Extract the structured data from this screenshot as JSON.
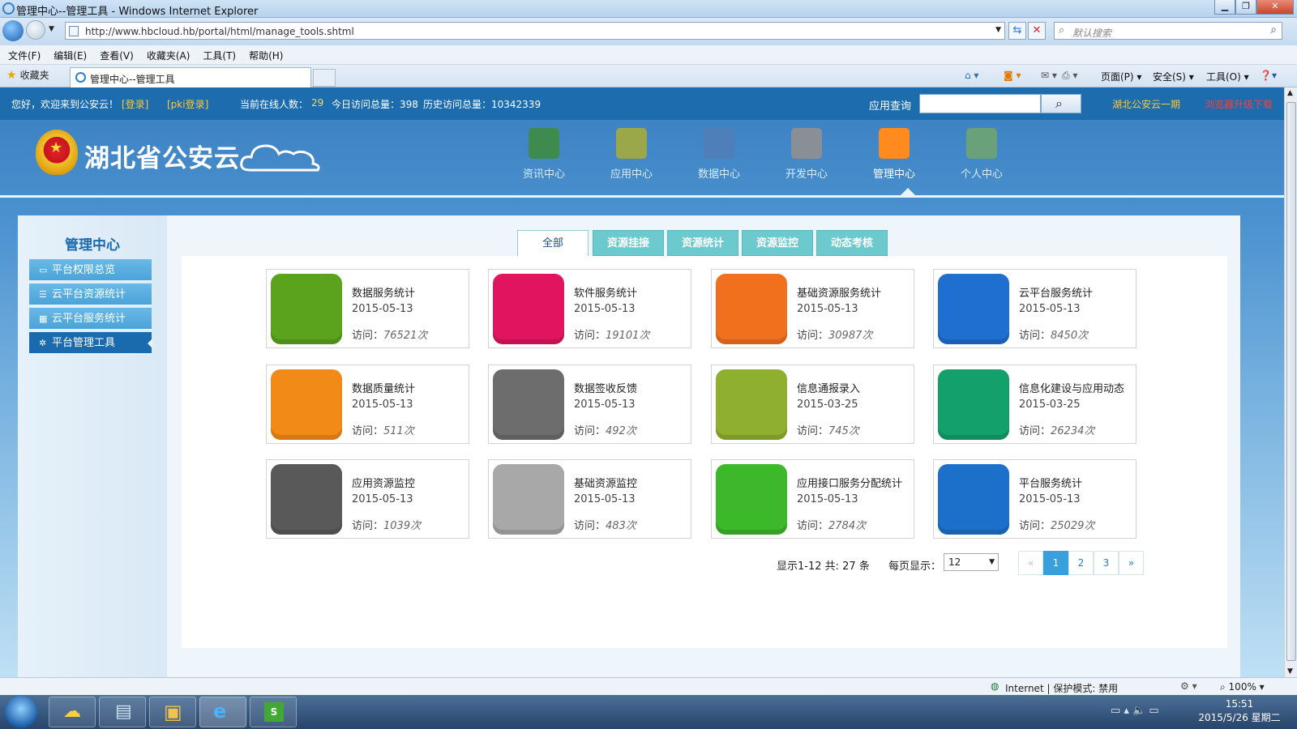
{
  "browser": {
    "window_title": "管理中心--管理工具 - Windows Internet Explorer",
    "url": "http://www.hbcloud.hb/portal/html/manage_tools.shtml",
    "search_placeholder": "默认搜索",
    "menu": [
      "文件(F)",
      "编辑(E)",
      "查看(V)",
      "收藏夹(A)",
      "工具(T)",
      "帮助(H)"
    ],
    "favorites_label": "收藏夹",
    "tab_title": "管理中心--管理工具",
    "commands": {
      "page": "页面(P)",
      "safety": "安全(S)",
      "tools": "工具(O)"
    },
    "status_zone": "Internet | 保护模式: 禁用",
    "zoom": "100%"
  },
  "site": {
    "welcome": "您好，欢迎来到公安云！",
    "login": "[登录]",
    "pki_login": "[pki登录]",
    "online_label": "当前在线人数：",
    "online_count": "29",
    "today_visits": "今日访问总量：398",
    "history_visits": "历史访问总量：10342339",
    "app_query_label": "应用查询",
    "phase_link": "湖北公安云一期",
    "browser_upgrade": "浏览器升级下载",
    "logo_text": "湖北省公安云",
    "nav": [
      {
        "label": "资讯中心",
        "icon": "news-icon",
        "color": "#3f8a4f"
      },
      {
        "label": "应用中心",
        "icon": "app-icon",
        "color": "#9aa84a"
      },
      {
        "label": "数据中心",
        "icon": "data-icon",
        "color": "#4f7fb8"
      },
      {
        "label": "开发中心",
        "icon": "dev-icon",
        "color": "#8a8f96"
      },
      {
        "label": "管理中心",
        "icon": "lock-icon",
        "color": "#ff8a1e"
      },
      {
        "label": "个人中心",
        "icon": "user-icon",
        "color": "#6aa07a"
      }
    ]
  },
  "sidebar": {
    "title": "管理中心",
    "items": [
      {
        "label": "平台权限总览",
        "icon": "window-icon"
      },
      {
        "label": "云平台资源统计",
        "icon": "list-icon"
      },
      {
        "label": "云平台服务统计",
        "icon": "grid-icon"
      },
      {
        "label": "平台管理工具",
        "icon": "gear-icon"
      }
    ]
  },
  "tabs": [
    "全部",
    "资源挂接",
    "资源统计",
    "资源监控",
    "动态考核"
  ],
  "cards": [
    {
      "name": "数据服务统计",
      "date": "2015-05-13",
      "visits": "76521",
      "icon": "pie-chart-icon",
      "color": "#5ba31d"
    },
    {
      "name": "软件服务统计",
      "date": "2015-05-13",
      "visits": "19101",
      "icon": "presentation-icon",
      "color": "#e0145f"
    },
    {
      "name": "基础资源服务统计",
      "date": "2015-05-13",
      "visits": "30987",
      "icon": "report-icon",
      "color": "#f0701e"
    },
    {
      "name": "云平台服务统计",
      "date": "2015-05-13",
      "visits": "8450",
      "icon": "cloud-edit-icon",
      "color": "#1e6fd0"
    },
    {
      "name": "数据质量统计",
      "date": "2015-05-13",
      "visits": "511",
      "icon": "bar-report-icon",
      "color": "#f28a18"
    },
    {
      "name": "数据签收反馈",
      "date": "2015-05-13",
      "visits": "492",
      "icon": "gear-chart-icon",
      "color": "#6d6d6d"
    },
    {
      "name": "信息通报录入",
      "date": "2015-03-25",
      "visits": "745",
      "icon": "monitor-icon",
      "color": "#8fb02e"
    },
    {
      "name": "信息化建设与应用动态",
      "date": "2015-03-25",
      "visits": "26234",
      "icon": "newspaper-icon",
      "color": "#14a06a"
    },
    {
      "name": "应用资源监控",
      "date": "2015-05-13",
      "visits": "1039",
      "icon": "presenter-icon",
      "color": "#595959"
    },
    {
      "name": "基础资源监控",
      "date": "2015-05-13",
      "visits": "483",
      "icon": "laptop-icon",
      "color": "#a8a8a8"
    },
    {
      "name": "应用接口服务分配统计",
      "date": "2015-05-13",
      "visits": "2784",
      "icon": "document-chart-icon",
      "color": "#3db82a"
    },
    {
      "name": "平台服务统计",
      "date": "2015-05-13",
      "visits": "25029",
      "icon": "pie-chart-icon",
      "color": "#1c70c9"
    }
  ],
  "card_labels": {
    "visit_prefix": "访问：",
    "visit_suffix": "次"
  },
  "pagination": {
    "summary": "显示1-12  共: 27 条",
    "per_page_label": "每页显示：",
    "per_page": "12",
    "pages": [
      "«",
      "1",
      "2",
      "3",
      "»"
    ],
    "current": "1"
  },
  "taskbar": {
    "time": "15:51",
    "date": "2015/5/26 星期二"
  }
}
